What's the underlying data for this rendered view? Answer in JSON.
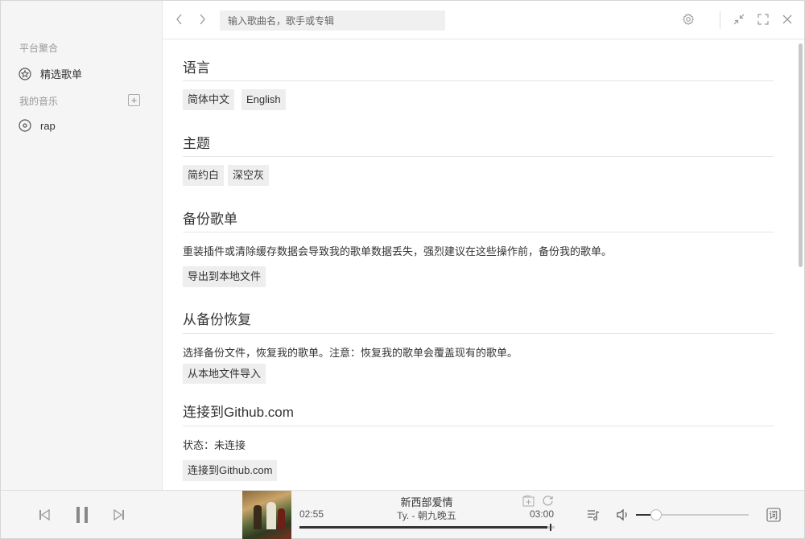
{
  "sidebar": {
    "section_platform": "平台聚合",
    "featured_playlists": "精选歌单",
    "section_my_music": "我的音乐",
    "add_icon": "plus-square-icon",
    "playlists": [
      {
        "label": "rap"
      }
    ]
  },
  "header": {
    "search_placeholder": "输入歌曲名，歌手或专辑"
  },
  "settings": {
    "language": {
      "title": "语言",
      "options": [
        "简体中文",
        "English"
      ]
    },
    "theme": {
      "title": "主题",
      "options": [
        "简约白",
        "深空灰"
      ]
    },
    "backup": {
      "title": "备份歌单",
      "description": "重装插件或清除缓存数据会导致我的歌单数据丢失，强烈建议在这些操作前，备份我的歌单。",
      "button": "导出到本地文件"
    },
    "restore": {
      "title": "从备份恢复",
      "description": "选择备份文件，恢复我的歌单。注意：恢复我的歌单会覆盖现有的歌单。",
      "button": "从本地文件导入"
    },
    "github": {
      "title": "连接到Github.com",
      "status": "状态：未连接",
      "button": "连接到Github.com"
    }
  },
  "player": {
    "title": "新西部爱情",
    "artist_song": "Ty. - 朝九晚五",
    "current_time": "02:55",
    "total_time": "03:00",
    "progress": 0.972,
    "volume": 0.18,
    "lyrics_label": "词"
  },
  "colors": {
    "sidebar_bg": "#f5f5f5",
    "button_bg": "#eeeeee",
    "text": "#333333"
  }
}
